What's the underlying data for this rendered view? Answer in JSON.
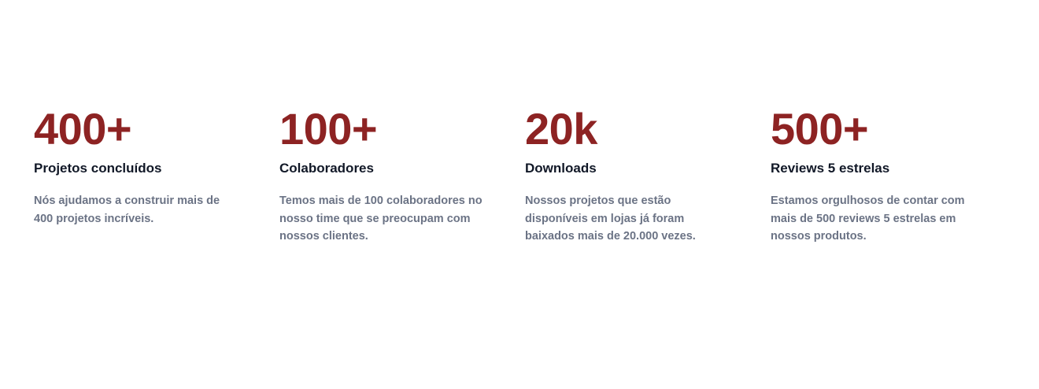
{
  "colors": {
    "accent": "#8d2323",
    "title": "#111827",
    "description": "#6b7385",
    "background": "#ffffff"
  },
  "stats": [
    {
      "value": "400+",
      "title": "Projetos concluídos",
      "description": "Nós ajudamos a construir mais de 400 projetos incríveis."
    },
    {
      "value": "100+",
      "title": "Colaboradores",
      "description": "Temos mais de 100 colaboradores no nosso time que se preocupam com nossos clientes."
    },
    {
      "value": "20k",
      "title": "Downloads",
      "description": "Nossos projetos que estão disponíveis em lojas já foram baixados mais de 20.000 vezes."
    },
    {
      "value": "500+",
      "title": "Reviews 5 estrelas",
      "description": "Estamos orgulhosos de contar com mais de 500 reviews 5 estrelas em nossos produtos."
    }
  ]
}
